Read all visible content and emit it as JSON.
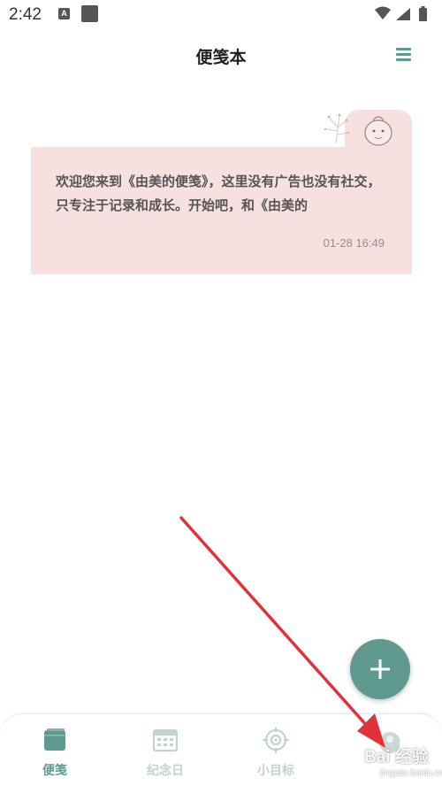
{
  "status_bar": {
    "time": "2:42",
    "notification_letter": "A",
    "icons": [
      "wifi-icon",
      "cell-signal-icon",
      "battery-icon"
    ]
  },
  "header": {
    "title": "便笺本",
    "menu_icon": "hamburger-menu-icon"
  },
  "notes": [
    {
      "text": "欢迎您来到《由美的便笺》，这里没有广告也没有社交，只专注于记录和成长。开始吧，和《由美的",
      "timestamp": "01-28 16:49"
    }
  ],
  "fab": {
    "icon": "plus-icon"
  },
  "bottom_nav": {
    "items": [
      {
        "label": "便笺",
        "icon": "notebook-icon",
        "active": true
      },
      {
        "label": "纪念日",
        "icon": "calendar-icon",
        "active": false
      },
      {
        "label": "小目标",
        "icon": "target-icon",
        "active": false
      },
      {
        "label": "",
        "icon": "profile-icon",
        "active": false
      }
    ]
  },
  "watermark": {
    "main": "Bai 经验",
    "sub": "jingyan.baidu.com"
  },
  "colors": {
    "accent": "#5f9990",
    "card_bg": "#f6e0e0",
    "inactive_nav": "#c2d3cf",
    "arrow": "#e0323a"
  }
}
